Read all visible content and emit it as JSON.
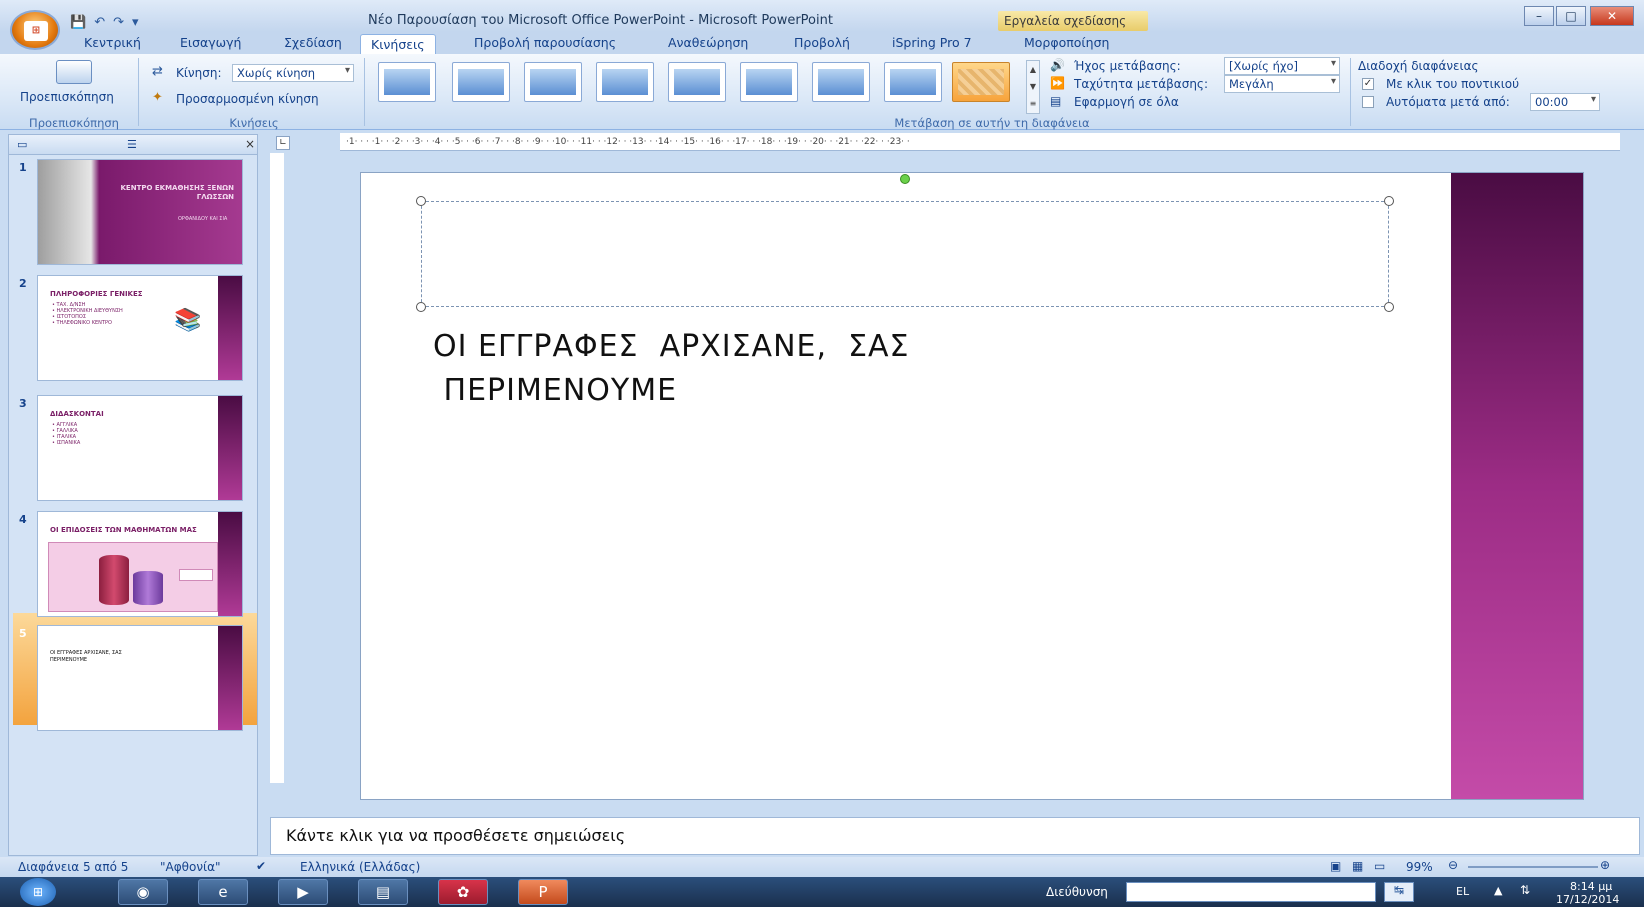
{
  "window": {
    "title": "Νέο Παρουσίαση του Microsoft Office PowerPoint - Microsoft PowerPoint",
    "context_tab": "Εργαλεία σχεδίασης",
    "min_label": "–",
    "max_label": "□",
    "close_label": "✕"
  },
  "tabs": [
    "Κεντρική",
    "Εισαγωγή",
    "Σχεδίαση",
    "Κινήσεις",
    "Προβολή παρουσίασης",
    "Αναθεώρηση",
    "Προβολή",
    "iSpring Pro 7",
    "Μορφοποίηση"
  ],
  "active_tab": "Κινήσεις",
  "ribbon": {
    "preview_label": "Προεπισκόπηση",
    "preview_group": "Προεπισκόπηση",
    "animation_label": "Κίνηση:",
    "animation_value": "Χωρίς κίνηση",
    "custom_animation": "Προσαρμοσμένη κίνηση",
    "animations_group": "Κινήσεις",
    "transition_group": "Μετάβαση σε αυτήν τη διαφάνεια",
    "sound_label": "Ήχος μετάβασης:",
    "sound_value": "[Χωρίς ήχο]",
    "speed_label": "Ταχύτητα μετάβασης:",
    "speed_value": "Μεγάλη",
    "apply_all": "Εφαρμογή σε όλα",
    "advance_title": "Διαδοχή διαφάνειας",
    "on_click": "Με κλικ του ποντικιού",
    "auto_after": "Αυτόματα μετά από:",
    "auto_time": "00:00"
  },
  "slides": [
    {
      "num": "1",
      "title": "ΚΕΝΤΡΟ ΕΚΜΑΘΗΣΗΣ ΞΕΝΩΝ ΓΛΩΣΣΩΝ",
      "bullets": "ΟΡΦΑΝΙΔΟΥ ΚΑΙ ΣΙΑ"
    },
    {
      "num": "2",
      "title": "ΠΛΗΡΟΦΟΡΙΕΣ ΓΕΝΙΚΕΣ",
      "bullets": "• ΤΑΧ. Δ/ΝΣΗ\n• ΗΛΕΚΤΡΟΝΙΚΗ ΔΙΕΥΘΥΝΣΗ\n• ΙΣΤΟΤΟΠΟΣ\n• ΤΗΛΕΦΩΝΙΚΟ ΚΕΝΤΡΟ"
    },
    {
      "num": "3",
      "title": "ΔΙΔΑΣΚΟΝΤΑΙ",
      "bullets": "• ΑΓΓΛΙΚΑ\n• ΓΑΛΛΙΚΑ\n• ΙΤΑΛΙΚΑ\n• ΙΣΠΑΝΙΚΑ"
    },
    {
      "num": "4",
      "title": "ΟΙ ΕΠΙΔΟΣΕΙΣ ΤΩΝ ΜΑΘΗΜΑΤΩΝ ΜΑΣ",
      "bullets": ""
    },
    {
      "num": "5",
      "title": "ΟΙ ΕΓΓΡΑΦΕΣ ΑΡΧΙΣΑΝΕ, ΣΑΣ ΠΕΡΙΜΕΝΟΥΜΕ",
      "bullets": ""
    }
  ],
  "main_slide": {
    "text": "ΟΙ ΕΓΓΡΑΦΕΣ  ΑΡΧΙΣΑΝΕ,  ΣΑΣ\n ΠΕΡΙΜΕΝΟΥΜΕ"
  },
  "ruler_h": "·1· ·  · ·1· · ·2· · ·3· · ·4· · ·5· · ·6· · ·7· · ·8· · ·9· · ·10· · ·11· · ·12· · ·13· · ·14· · ·15· · ·16· · ·17· · ·18· · ·19· · ·20· · ·21· · ·22· · ·23· ·",
  "notes_placeholder": "Κάντε κλικ για να προσθέσετε σημειώσεις",
  "status": {
    "slide_info": "Διαφάνεια 5 από 5",
    "theme": "\"Αφθονία\"",
    "language": "Ελληνικά (Ελλάδας)",
    "zoom": "99%"
  },
  "taskbar": {
    "address_label": "Διεύθυνση",
    "lang": "EL",
    "time": "8:14 μμ",
    "date": "17/12/2014"
  }
}
